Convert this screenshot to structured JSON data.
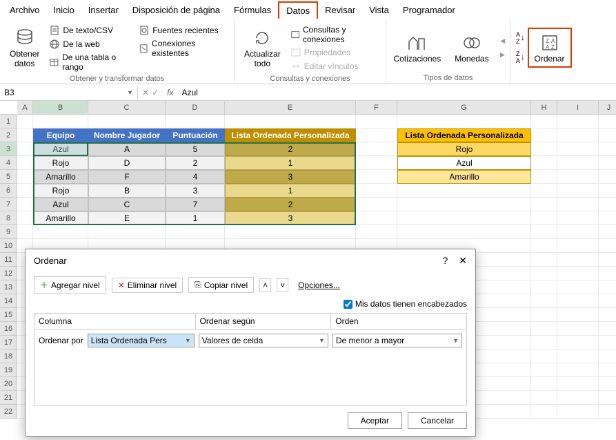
{
  "menu": [
    "Archivo",
    "Inicio",
    "Insertar",
    "Disposición de página",
    "Fórmulas",
    "Datos",
    "Revisar",
    "Vista",
    "Programador"
  ],
  "menu_active_index": 5,
  "ribbon": {
    "obtener": {
      "label": "Obtener\ndatos",
      "group": "Obtener y transformar datos",
      "items": [
        "De texto/CSV",
        "De la web",
        "De una tabla o rango",
        "Fuentes recientes",
        "Conexiones existentes"
      ]
    },
    "actualizar": {
      "label": "Actualizar\ntodo",
      "group": "Consultas y conexiones",
      "items": [
        "Consultas y conexiones",
        "Propiedades",
        "Editar vínculos"
      ]
    },
    "tipos": {
      "group": "Tipos de datos",
      "items": [
        "Cotizaciones",
        "Monedas"
      ]
    },
    "ordenar": {
      "az": "A→Z",
      "za": "Z→A",
      "ordenar": "Ordenar"
    }
  },
  "namebox": "B3",
  "formula_value": "Azul",
  "cols": [
    "A",
    "B",
    "C",
    "D",
    "E",
    "F",
    "G",
    "H",
    "I",
    "J"
  ],
  "rows": [
    "1",
    "2",
    "3",
    "4",
    "5",
    "6",
    "7",
    "8",
    "9",
    "10",
    "11",
    "12",
    "13",
    "14",
    "15",
    "16",
    "17",
    "18",
    "19",
    "20",
    "21",
    "22"
  ],
  "table1": {
    "headers": [
      "Equipo",
      "Nombre Jugador",
      "Puntuación",
      "Lista Ordenada Personalizada"
    ],
    "rows": [
      [
        "Azul",
        "A",
        "5",
        "2"
      ],
      [
        "Rojo",
        "D",
        "2",
        "1"
      ],
      [
        "Amarillo",
        "F",
        "4",
        "3"
      ],
      [
        "Rojo",
        "B",
        "3",
        "1"
      ],
      [
        "Azul",
        "C",
        "7",
        "2"
      ],
      [
        "Amarillo",
        "E",
        "1",
        "3"
      ]
    ]
  },
  "table2": {
    "header": "Lista Ordenada Personalizada",
    "rows": [
      "Rojo",
      "Azul",
      "Amarillo"
    ]
  },
  "dialog": {
    "title": "Ordenar",
    "add": "Agregar nivel",
    "del": "Eliminar nivel",
    "copy": "Copiar nivel",
    "options": "Opciones...",
    "headers_chk": "Mis datos tienen encabezados",
    "col_hdr": "Columna",
    "sort_hdr": "Ordenar según",
    "order_hdr": "Orden",
    "sortby": "Ordenar por",
    "col_val": "Lista Ordenada Pers",
    "sort_val": "Valores de celda",
    "order_val": "De menor a mayor",
    "ok": "Aceptar",
    "cancel": "Cancelar"
  }
}
